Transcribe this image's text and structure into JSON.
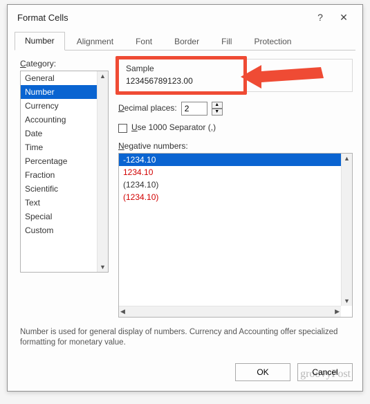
{
  "dialog": {
    "title": "Format Cells",
    "help_symbol": "?",
    "close_symbol": "✕"
  },
  "tabs": [
    {
      "label": "Number",
      "active": true
    },
    {
      "label": "Alignment",
      "active": false
    },
    {
      "label": "Font",
      "active": false
    },
    {
      "label": "Border",
      "active": false
    },
    {
      "label": "Fill",
      "active": false
    },
    {
      "label": "Protection",
      "active": false
    }
  ],
  "category": {
    "label": "Category:",
    "items": [
      "General",
      "Number",
      "Currency",
      "Accounting",
      "Date",
      "Time",
      "Percentage",
      "Fraction",
      "Scientific",
      "Text",
      "Special",
      "Custom"
    ],
    "selected_index": 1
  },
  "sample": {
    "label": "Sample",
    "value": "123456789123.00"
  },
  "decimal": {
    "label": "Decimal places:",
    "value": "2"
  },
  "separator": {
    "label": "Use 1000 Separator (,)",
    "checked": false
  },
  "negative": {
    "label": "Negative numbers:",
    "items": [
      {
        "text": "-1234.10",
        "style": "sel"
      },
      {
        "text": "1234.10",
        "style": "red"
      },
      {
        "text": "(1234.10)",
        "style": ""
      },
      {
        "text": "(1234.10)",
        "style": "red"
      }
    ]
  },
  "description": "Number is used for general display of numbers.  Currency and Accounting offer specialized formatting for monetary value.",
  "buttons": {
    "ok": "OK",
    "cancel": "Cancel"
  },
  "watermark": "groovyPost",
  "highlight_color": "#ef4b34"
}
